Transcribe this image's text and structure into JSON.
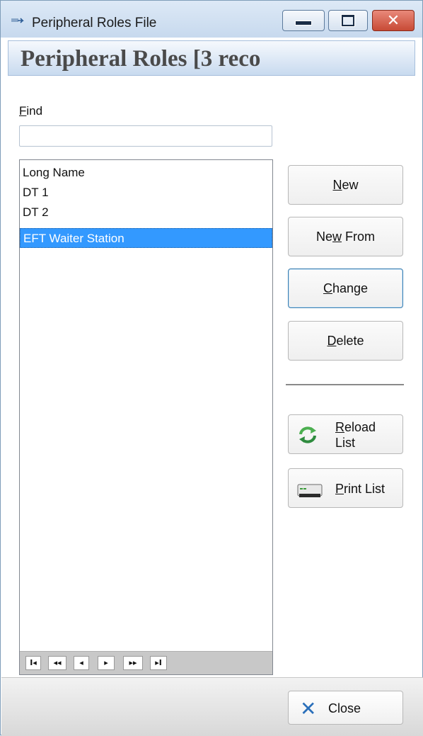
{
  "window": {
    "title": "Peripheral Roles File"
  },
  "header": {
    "banner": "Peripheral Roles [3 reco"
  },
  "find": {
    "label": "Find",
    "value": "",
    "placeholder": ""
  },
  "list": {
    "column": "Long Name",
    "rows": [
      "DT 1",
      "DT 2",
      "EFT Waiter Station"
    ],
    "selected_index": 2
  },
  "navigation": [
    "I◂",
    "◂◂",
    "◂",
    "▸",
    "▸▸",
    "▸I"
  ],
  "buttons": {
    "new": "New",
    "new_from": "New From",
    "change": "Change",
    "delete": "Delete",
    "reload_line1": "Reload",
    "reload_line2": "List",
    "print": "Print List",
    "close": "Close"
  },
  "colors": {
    "selection": "#3399ff",
    "accent": "#2a6fba"
  }
}
